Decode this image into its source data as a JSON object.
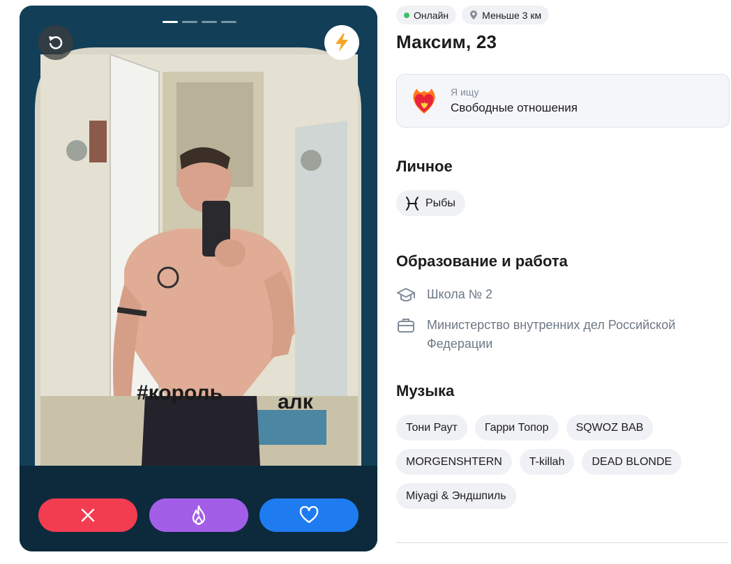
{
  "card": {
    "photo_segments": 4,
    "active_segment": 1,
    "undo_icon": "undo-icon",
    "boost_icon": "lightning-icon",
    "photo_caption_text": "#король алк"
  },
  "actions": {
    "dislike_icon": "close-icon",
    "superlike_icon": "flame-icon",
    "like_icon": "heart-icon"
  },
  "profile": {
    "status_online": "Онлайн",
    "distance": "Меньше 3 км",
    "name": "Максим, 23",
    "looking_label": "Я ищу",
    "looking_value": "Свободные отношения"
  },
  "personal": {
    "title": "Личное",
    "zodiac": "Рыбы"
  },
  "education": {
    "title": "Образование и работа",
    "school": "Школа № 2",
    "work": "Министерство внутренних дел Российской Федерации"
  },
  "music": {
    "title": "Музыка",
    "artists": [
      "Тони Раут",
      "Гарри Топор",
      "SQWOZ BAB",
      "MORGENSHTERN",
      "T-killah",
      "DEAD BLONDE",
      "Miyagi & Эндшпиль"
    ]
  },
  "colors": {
    "dislike": "#f23c50",
    "superlike": "#a35ee8",
    "like": "#1f7bf0",
    "online": "#3cc26a",
    "boost": "#f5a623"
  }
}
